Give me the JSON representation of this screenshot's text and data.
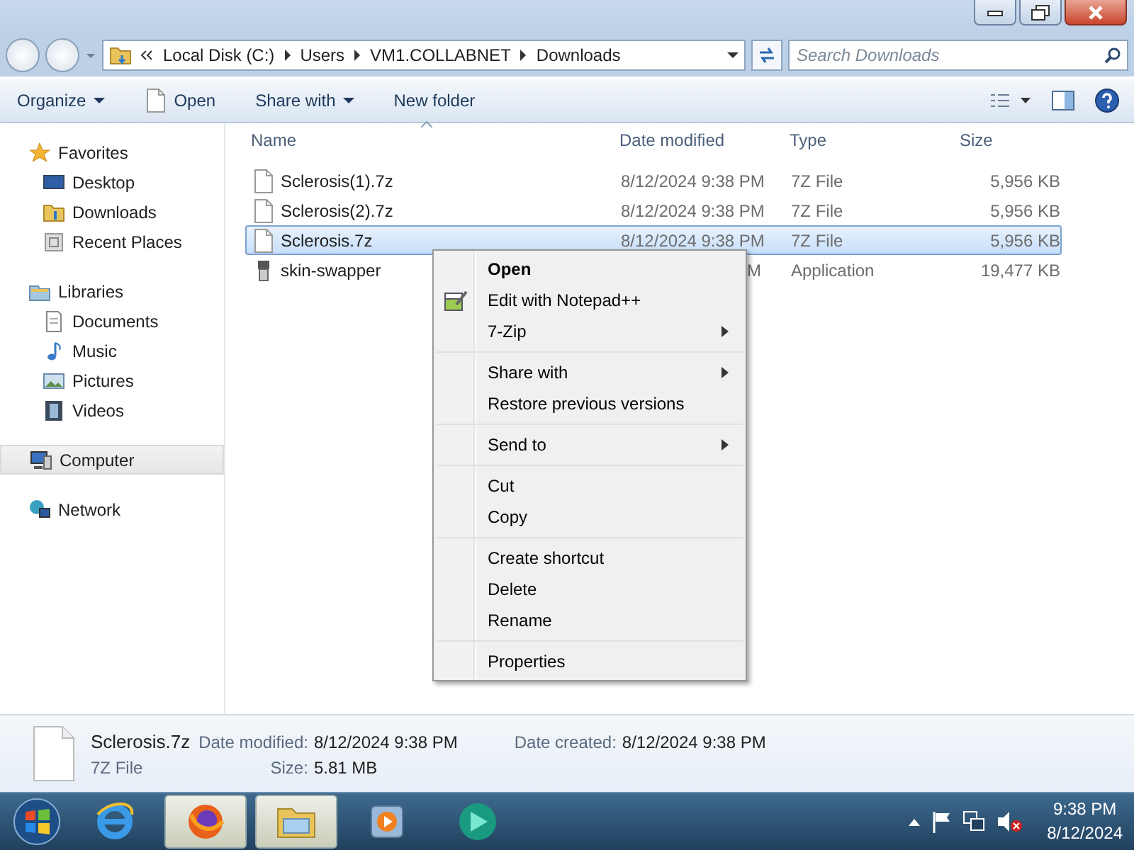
{
  "address_bar": {
    "segments": [
      "Local Disk (C:)",
      "Users",
      "VM1.COLLABNET",
      "Downloads"
    ]
  },
  "search": {
    "placeholder": "Search Downloads"
  },
  "toolbar": [
    {
      "label": "Organize",
      "kind": "menu"
    },
    {
      "label": "Open",
      "kind": "file"
    },
    {
      "label": "Share with",
      "kind": "menu"
    },
    {
      "label": "New folder",
      "kind": "plain"
    }
  ],
  "sidebar": {
    "groups": [
      {
        "label": "Favorites",
        "kind": "star",
        "selected": false,
        "children": [
          {
            "label": "Desktop",
            "kind": "desktop",
            "selected": false
          },
          {
            "label": "Downloads",
            "kind": "downloads",
            "selected": false
          },
          {
            "label": "Recent Places",
            "kind": "recent",
            "selected": false
          }
        ]
      },
      {
        "label": "Libraries",
        "kind": "library",
        "selected": false,
        "children": [
          {
            "label": "Documents",
            "kind": "documents",
            "selected": false
          },
          {
            "label": "Music",
            "kind": "music",
            "selected": false
          },
          {
            "label": "Pictures",
            "kind": "pictures",
            "selected": false
          },
          {
            "label": "Videos",
            "kind": "videos",
            "selected": false
          }
        ]
      },
      {
        "label": "Computer",
        "kind": "computer",
        "selected": true
      },
      {
        "label": "Network",
        "kind": "network",
        "selected": false
      }
    ]
  },
  "table": {
    "columns": [
      "Name",
      "Date modified",
      "Type",
      "Size"
    ],
    "rows": [
      {
        "name": "Sclerosis(1).7z",
        "date_modified": "8/12/2024 9:38 PM",
        "type": "7Z File",
        "size": "5,956 KB",
        "kind": "file",
        "selected": false
      },
      {
        "name": "Sclerosis(2).7z",
        "date_modified": "8/12/2024 9:38 PM",
        "type": "7Z File",
        "size": "5,956 KB",
        "kind": "file",
        "selected": false
      },
      {
        "name": "Sclerosis.7z",
        "date_modified": "8/12/2024 9:38 PM",
        "type": "7Z File",
        "size": "5,956 KB",
        "kind": "file",
        "selected": true
      },
      {
        "name": "skin-swapper",
        "date_modified": "M",
        "type": "Application",
        "size": "19,477 KB",
        "kind": "app",
        "selected": false
      }
    ]
  },
  "context_menu": {
    "groups": [
      [
        {
          "label": "Open",
          "default": true,
          "submenu": false,
          "has_icon": false
        },
        {
          "label": "Edit with Notepad++",
          "default": false,
          "submenu": false,
          "has_icon": true
        },
        {
          "label": "7-Zip",
          "default": false,
          "submenu": true,
          "has_icon": false
        }
      ],
      [
        {
          "label": "Share with",
          "default": false,
          "submenu": true,
          "has_icon": false
        },
        {
          "label": "Restore previous versions",
          "default": false,
          "submenu": false,
          "has_icon": false
        }
      ],
      [
        {
          "label": "Send to",
          "default": false,
          "submenu": true,
          "has_icon": false
        }
      ],
      [
        {
          "label": "Cut",
          "default": false,
          "submenu": false,
          "has_icon": false
        },
        {
          "label": "Copy",
          "default": false,
          "submenu": false,
          "has_icon": false
        }
      ],
      [
        {
          "label": "Create shortcut",
          "default": false,
          "submenu": false,
          "has_icon": false
        },
        {
          "label": "Delete",
          "default": false,
          "submenu": false,
          "has_icon": false
        },
        {
          "label": "Rename",
          "default": false,
          "submenu": false,
          "has_icon": false
        }
      ],
      [
        {
          "label": "Properties",
          "default": false,
          "submenu": false,
          "has_icon": false
        }
      ]
    ]
  },
  "details_pane": {
    "name": "Sclerosis.7z",
    "type": "7Z File",
    "fields": [
      {
        "label": "Date modified:",
        "value": "8/12/2024 9:38 PM"
      },
      {
        "label": "Size:",
        "value": "5.81 MB"
      },
      {
        "label": "Date created:",
        "value": "8/12/2024 9:38 PM"
      }
    ]
  },
  "taskbar": {
    "apps": [
      {
        "kind": "browser-e",
        "selected": false
      },
      {
        "kind": "firefox",
        "selected": true
      },
      {
        "kind": "folder",
        "selected": true
      },
      {
        "kind": "media",
        "selected": false
      },
      {
        "kind": "circle-app",
        "selected": false
      }
    ],
    "clock": {
      "time": "9:38 PM",
      "date": "8/12/2024"
    }
  }
}
